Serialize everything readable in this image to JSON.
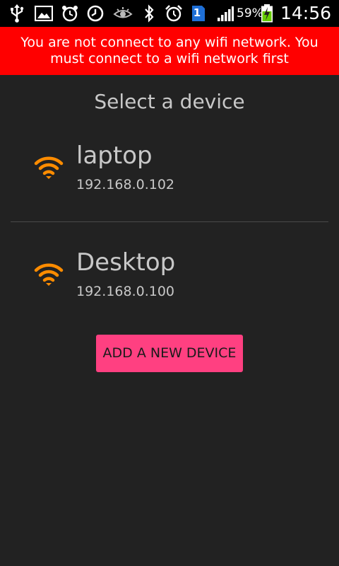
{
  "status_bar": {
    "icons": [
      "usb-icon",
      "image-icon",
      "alarm-icon",
      "clock-icon",
      "eye-icon",
      "bluetooth-icon",
      "alarm-clock-icon",
      "sim-icon",
      "signal-icon",
      "battery-charging-icon"
    ],
    "sim_label": "1",
    "battery_percent": "59%",
    "time": "14:56"
  },
  "warning": {
    "text": "You are not connect to any wifi network. You must connect to a wifi network first",
    "background": "#ff0000"
  },
  "screen_title": "Select a device",
  "devices": [
    {
      "name": "laptop",
      "ip": "192.168.0.102",
      "icon": "wifi-icon"
    },
    {
      "name": "Desktop",
      "ip": "192.168.0.100",
      "icon": "wifi-icon"
    }
  ],
  "add_button": {
    "label": "ADD A NEW DEVICE",
    "color": "#ff4081"
  },
  "colors": {
    "background": "#222222",
    "wifi_icon": "#ff8c00",
    "text": "#c8c8c8"
  }
}
